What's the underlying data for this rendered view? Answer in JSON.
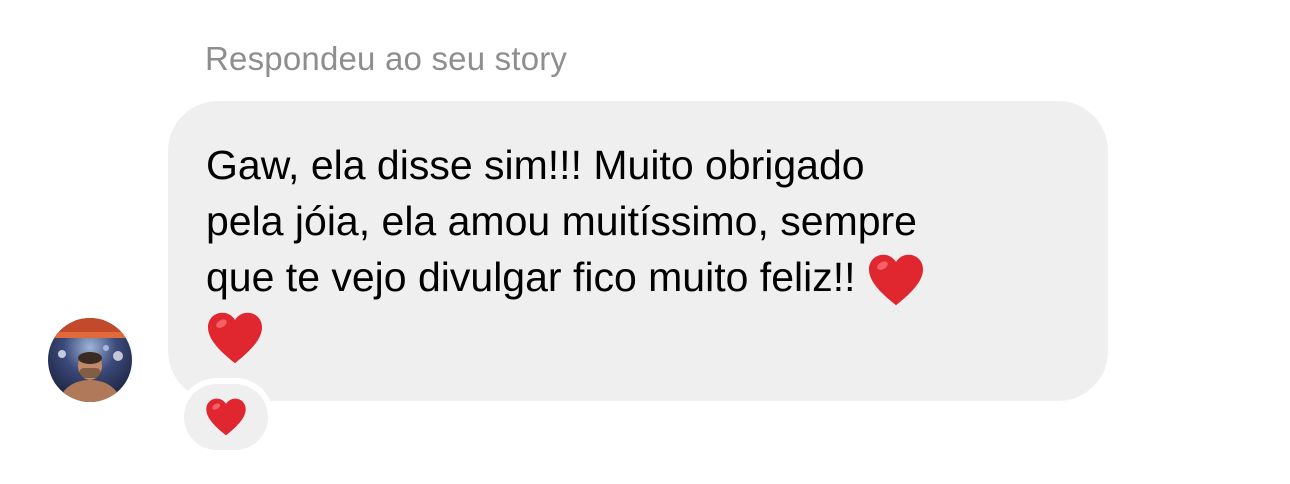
{
  "message": {
    "reply_context": "Respondeu ao seu story",
    "text_line_1": "Gaw, ela disse sim!!! Muito obrigado",
    "text_line_2": "pela jóia, ela amou muitíssimo, sempre",
    "text_line_3": "que te vejo divulgar fico muito feliz!!",
    "inline_emoji_icons": [
      "red-heart-icon",
      "red-heart-icon"
    ]
  },
  "reaction": {
    "icon": "red-heart-icon"
  },
  "colors": {
    "bubble_background": "#efefef",
    "reply_context_text": "#8e8e8e",
    "heart": "#e0262e"
  }
}
